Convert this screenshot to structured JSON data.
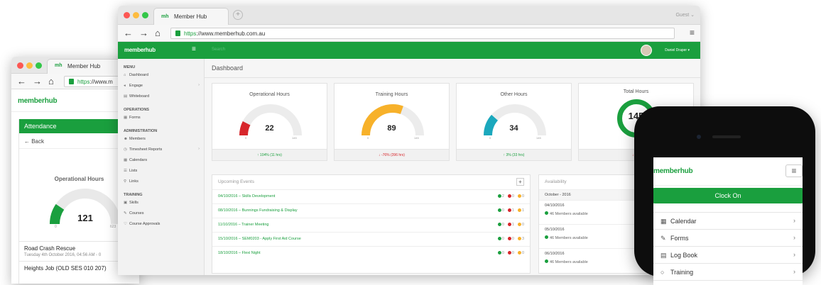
{
  "left_window": {
    "tab_title": "Member Hub",
    "favicon": "mh",
    "url_https": "https",
    "url_rest": "://www.m",
    "logo": "memberhub",
    "header": "Attendance",
    "back": "← Back",
    "gauge_title": "Operational Hours",
    "gauge_value": "121",
    "gauge_min": "0",
    "gauge_max": "623",
    "gauge_fraction": 0.19,
    "event_title": "Road Crash Rescue",
    "event_time": "Tuesday 4th October 2016, 04:56 AM - 0",
    "event2_title": "Heights Job (OLD SES 010 207)"
  },
  "main_window": {
    "tab_title": "Member Hub",
    "favicon": "mh",
    "user_menu": "Guest",
    "url_https": "https",
    "url_rest": "://www.memberhub.com.au",
    "logo": "memberhub",
    "topbar_search": "Search",
    "user_name": "Daniel Draper",
    "page_title": "Dashboard",
    "sidebar": [
      {
        "type": "section",
        "label": "MENU"
      },
      {
        "type": "item",
        "label": "Dashboard",
        "icon": "⌂"
      },
      {
        "type": "item",
        "label": "Engage",
        "icon": "◂",
        "chevron": true
      },
      {
        "type": "item",
        "label": "Whiteboard",
        "icon": "▤"
      },
      {
        "type": "section",
        "label": "OPERATIONS"
      },
      {
        "type": "item",
        "label": "Forms",
        "icon": "▦"
      },
      {
        "type": "section",
        "label": "ADMINISTRATION"
      },
      {
        "type": "item",
        "label": "Members",
        "icon": "☻"
      },
      {
        "type": "item",
        "label": "Timesheet Reports",
        "icon": "◷",
        "chevron": true
      },
      {
        "type": "item",
        "label": "Calendars",
        "icon": "▦"
      },
      {
        "type": "item",
        "label": "Lists",
        "icon": "☰"
      },
      {
        "type": "item",
        "label": "Links",
        "icon": "⚲"
      },
      {
        "type": "section",
        "label": "TRAINING"
      },
      {
        "type": "item",
        "label": "Skills",
        "icon": "▣"
      },
      {
        "type": "item",
        "label": "Courses",
        "icon": "✎"
      },
      {
        "type": "item",
        "label": "Course Approvals",
        "icon": "♡"
      }
    ],
    "cards": [
      {
        "title": "Operational Hours",
        "value": "22",
        "min": "0",
        "max": "145",
        "fraction": 0.15,
        "color": "#d7262b",
        "footer": "104% (11 hrs)",
        "trend": "up"
      },
      {
        "title": "Training Hours",
        "value": "89",
        "min": "0",
        "max": "145",
        "fraction": 0.61,
        "color": "#f7b12a",
        "footer": "-76% (396 hrs)",
        "trend": "down"
      },
      {
        "title": "Other Hours",
        "value": "34",
        "min": "0",
        "max": "145",
        "fraction": 0.23,
        "color": "#1ba8bd",
        "footer": "3% (33 hrs)",
        "trend": "up"
      },
      {
        "title": "Total Hours",
        "value": "145",
        "footer": "-67",
        "trend": "down",
        "color": "#1a9f3e"
      }
    ],
    "events_title": "Upcoming Events",
    "events": [
      {
        "label": "04/10/2016 – Skills Development",
        "counts": [
          "2",
          "0",
          "0"
        ]
      },
      {
        "label": "08/10/2016 – Bunnings Fundraising & Display",
        "counts": [
          "0",
          "1",
          "1"
        ]
      },
      {
        "label": "11/10/2016 – Trainer Meeting",
        "counts": [
          "0",
          "1",
          "0"
        ]
      },
      {
        "label": "15/10/2016 – SEM0203 - Apply First Aid Course",
        "counts": [
          "0",
          "0",
          "3"
        ]
      },
      {
        "label": "18/10/2016 – Flexi Night",
        "counts": [
          "0",
          "0",
          "0"
        ]
      }
    ],
    "availability_title": "Availability",
    "availability_month": "October - 2016",
    "availability": [
      {
        "date": "04/10/2016",
        "text": "46 Members available"
      },
      {
        "date": "05/10/2016",
        "text": "46 Members available"
      },
      {
        "date": "06/10/2016",
        "text": "46 Members available"
      }
    ]
  },
  "phone": {
    "logo": "memberhub",
    "clock_button": "Clock On",
    "menu": [
      {
        "label": "Calendar",
        "icon": "▦"
      },
      {
        "label": "Forms",
        "icon": "✎"
      },
      {
        "label": "Log Book",
        "icon": "▤"
      },
      {
        "label": "Training",
        "icon": "○"
      }
    ]
  },
  "colors": {
    "brand": "#1a9f3e",
    "red": "#d7262b",
    "amber": "#f7b12a",
    "teal": "#1ba8bd"
  }
}
